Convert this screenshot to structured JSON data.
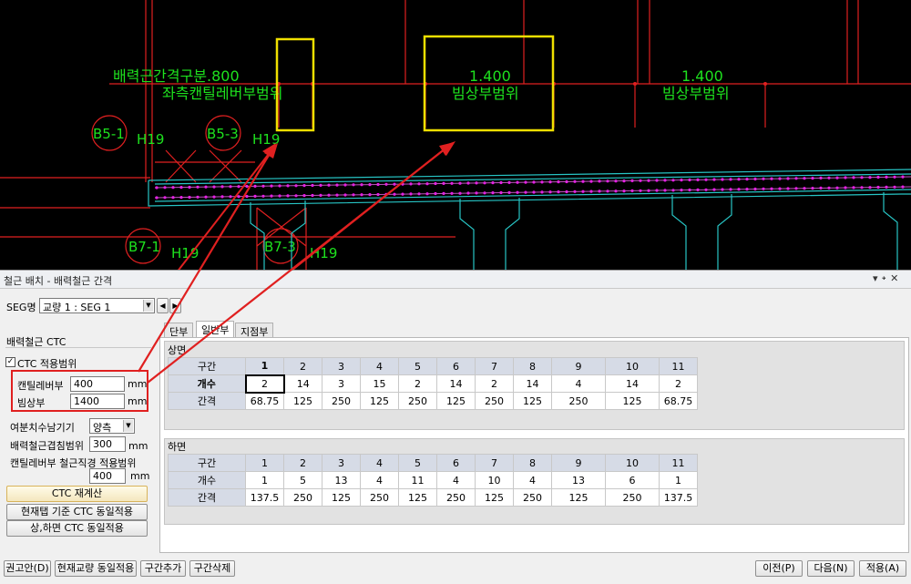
{
  "cad": {
    "labels": {
      "section_label": "배력근간격구분.800",
      "left_range": "좌측캔틸레버부범위",
      "dim_1": "1.400",
      "range_1": "빔상부범위",
      "dim_2": "1.400",
      "range_2": "빔상부범위",
      "b5_1": "B5-1",
      "b5_3": "B5-3",
      "b7_1": "B7-1",
      "b7_3": "B7-3",
      "h19_a": "H19",
      "h19_b": "H19",
      "h19_c": "H19",
      "h19_d": "H19"
    }
  },
  "panel": {
    "title": "철근 배치 - 배력철근 간격",
    "title_controls": "▾ ᛭ ✕",
    "seg_label": "SEG명",
    "seg_value": "교량 1 : SEG 1",
    "group_title": "배력철근 CTC",
    "ctc_checkbox_label": "CTC 적용범위",
    "cantilever_label": "캔틸레버부",
    "cantilever_value": "400",
    "beam_label": "빔상부",
    "beam_value": "1400",
    "unit_mm": "mm",
    "remainder_label": "여분치수남기기",
    "remainder_value": "양측",
    "lap_label": "배력철근겹침범위",
    "lap_value": "300",
    "cant_dia_label": "캔틸레버부 철근직경 적용범위",
    "cant_dia_value": "400",
    "recalc_button": "CTC 재계산",
    "same_tab_button": "현재탭 기준 CTC 동일적용",
    "updown_button": "상,하면 CTC 동일적용",
    "tabs": [
      "단부",
      "일반부",
      "지점부"
    ],
    "active_tab": 1,
    "top_section": "상면",
    "bottom_section": "하면"
  },
  "top_table": {
    "row_labels": [
      "구간",
      "개수",
      "간격"
    ],
    "columns": [
      "1",
      "2",
      "3",
      "4",
      "5",
      "6",
      "7",
      "8",
      "9",
      "10",
      "11"
    ],
    "count": [
      "2",
      "14",
      "3",
      "15",
      "2",
      "14",
      "2",
      "14",
      "4",
      "14",
      "2"
    ],
    "spacing": [
      "68.75",
      "125",
      "250",
      "125",
      "250",
      "125",
      "250",
      "125",
      "250",
      "125",
      "68.75"
    ]
  },
  "bottom_table": {
    "row_labels": [
      "구간",
      "개수",
      "간격"
    ],
    "columns": [
      "1",
      "2",
      "3",
      "4",
      "5",
      "6",
      "7",
      "8",
      "9",
      "10",
      "11"
    ],
    "count": [
      "1",
      "5",
      "13",
      "4",
      "11",
      "4",
      "10",
      "4",
      "13",
      "6",
      "1"
    ],
    "spacing": [
      "137.5",
      "250",
      "125",
      "250",
      "125",
      "250",
      "125",
      "250",
      "125",
      "250",
      "137.5"
    ]
  },
  "footer": {
    "recommend_button": "권고안(D)",
    "same_bridge_button": "현재교량 동일적용",
    "add_section_button": "구간추가",
    "delete_section_button": "구간삭제",
    "prev_button": "이전(P)",
    "next_button": "다음(N)",
    "apply_button": "적용(A)"
  },
  "colors": {
    "cad_background": "#000000",
    "cad_green_text": "#1ee11e",
    "highlight_yellow": "#f0e000",
    "annotation_red": "#e02020",
    "rebar_magenta": "#ff00ff",
    "girder_cyan": "#27c5c5"
  }
}
